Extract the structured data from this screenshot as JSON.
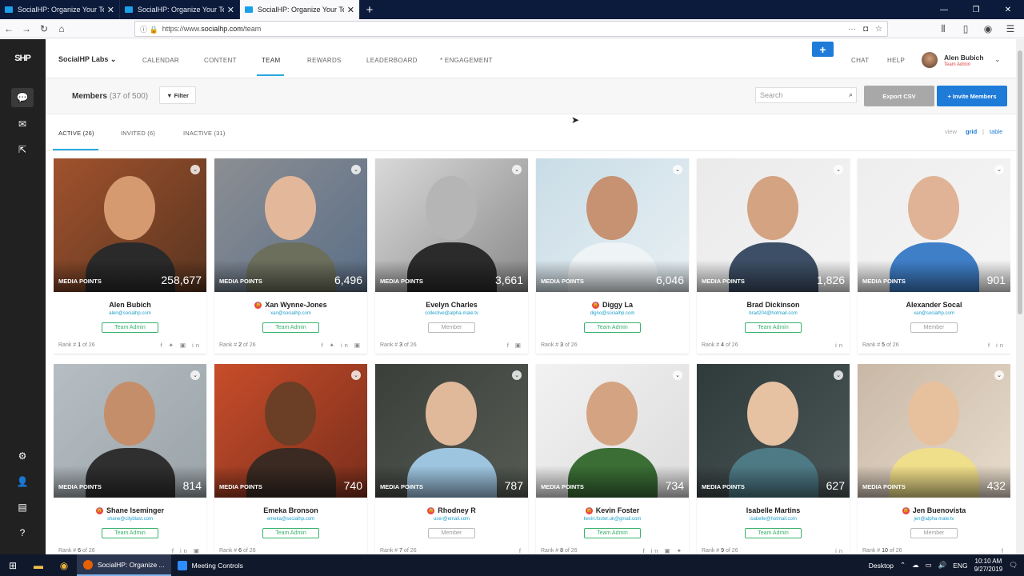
{
  "browser": {
    "tabs": [
      {
        "title": "SocialHP: Organize Your Team"
      },
      {
        "title": "SocialHP: Organize Your Team"
      },
      {
        "title": "SocialHP: Organize Your Team"
      }
    ],
    "url_prefix": "https://www.",
    "url_domain": "socialhp.com",
    "url_path": "/team"
  },
  "app": {
    "logo": "SHP",
    "org": "SocialHP Labs",
    "nav": [
      "CALENDAR",
      "CONTENT",
      "TEAM",
      "REWARDS",
      "LEADERBOARD",
      "* ENGAGEMENT"
    ],
    "right_nav": [
      "CHAT",
      "HELP"
    ],
    "plus_label": "+",
    "user": {
      "name": "Alen Bubich",
      "role": "Team Admin"
    }
  },
  "toolbar": {
    "members_label": "Members",
    "members_count": "(37 of 500)",
    "filter_label": "Filter",
    "search_placeholder": "Search",
    "export_label": "Export CSV",
    "invite_label": "+ Invite Members"
  },
  "filter_tabs": [
    "ACTIVE (26)",
    "INVITED (6)",
    "INACTIVE (31)"
  ],
  "view_toggle": {
    "view": "view",
    "grid": "grid",
    "sep": "|",
    "table": "table"
  },
  "media_points_label": "MEDIA POINTS",
  "members": [
    {
      "name": "Alen Bubich",
      "email": "alen@socialhp.com",
      "role": "Team Admin",
      "points": "258,677",
      "rank": "1",
      "of": "26",
      "locked": false,
      "social": "f ✦ ▣ in"
    },
    {
      "name": "Xan Wynne-Jones",
      "email": "xan@socialhp.com",
      "role": "Team Admin",
      "points": "6,496",
      "rank": "2",
      "of": "26",
      "locked": true,
      "social": "f ✦ in ▣"
    },
    {
      "name": "Evelyn Charles",
      "email": "collective@alpha-male.tv",
      "role": "Member",
      "points": "3,661",
      "rank": "3",
      "of": "26",
      "locked": false,
      "social": "f ▣"
    },
    {
      "name": "Diggy La",
      "email": "digno@socialhp.com",
      "role": "Team Admin",
      "points": "6,046",
      "rank": "3",
      "of": "26",
      "locked": true,
      "social": ""
    },
    {
      "name": "Brad Dickinson",
      "email": "brad204@hotmail.com",
      "role": "Team Admin",
      "points": "1,826",
      "rank": "4",
      "of": "26",
      "locked": false,
      "social": "in"
    },
    {
      "name": "Alexander Socal",
      "email": "xan@socialhp.com",
      "role": "Member",
      "points": "901",
      "rank": "5",
      "of": "26",
      "locked": false,
      "social": "f in"
    },
    {
      "name": "Shane Iseminger",
      "email": "shane@cityblast.com",
      "role": "Team Admin",
      "points": "814",
      "rank": "6",
      "of": "26",
      "locked": true,
      "social": "f in ▣"
    },
    {
      "name": "Emeka Bronson",
      "email": "emeka@socialhp.com",
      "role": "Team Admin",
      "points": "740",
      "rank": "6",
      "of": "26",
      "locked": false,
      "social": ""
    },
    {
      "name": "Rhodney R",
      "email": "user@email.com",
      "role": "Member",
      "points": "787",
      "rank": "7",
      "of": "26",
      "locked": true,
      "social": "f"
    },
    {
      "name": "Kevin Foster",
      "email": "kevin.foster.uk@gmail.com",
      "role": "Team Admin",
      "points": "734",
      "rank": "8",
      "of": "26",
      "locked": true,
      "social": "f in ▣ ✦"
    },
    {
      "name": "Isabelle Martins",
      "email": "isabelle@hotmail.com",
      "role": "Team Admin",
      "points": "627",
      "rank": "9",
      "of": "26",
      "locked": false,
      "social": "in"
    },
    {
      "name": "Jen Buenovista",
      "email": "jen@alpha-male.tv",
      "role": "Member",
      "points": "432",
      "rank": "10",
      "of": "26",
      "locked": true,
      "social": "f"
    }
  ],
  "rank_prefix": "Rank #",
  "rank_of": "of",
  "taskbar": {
    "apps": [
      {
        "label": "SocialHP: Organize ...",
        "color": "#e66000"
      },
      {
        "label": "Meeting Controls",
        "color": "#2d8cff"
      }
    ],
    "desktop": "Desktop",
    "lang": "ENG",
    "time": "10:10 AM",
    "date": "9/27/2019"
  }
}
